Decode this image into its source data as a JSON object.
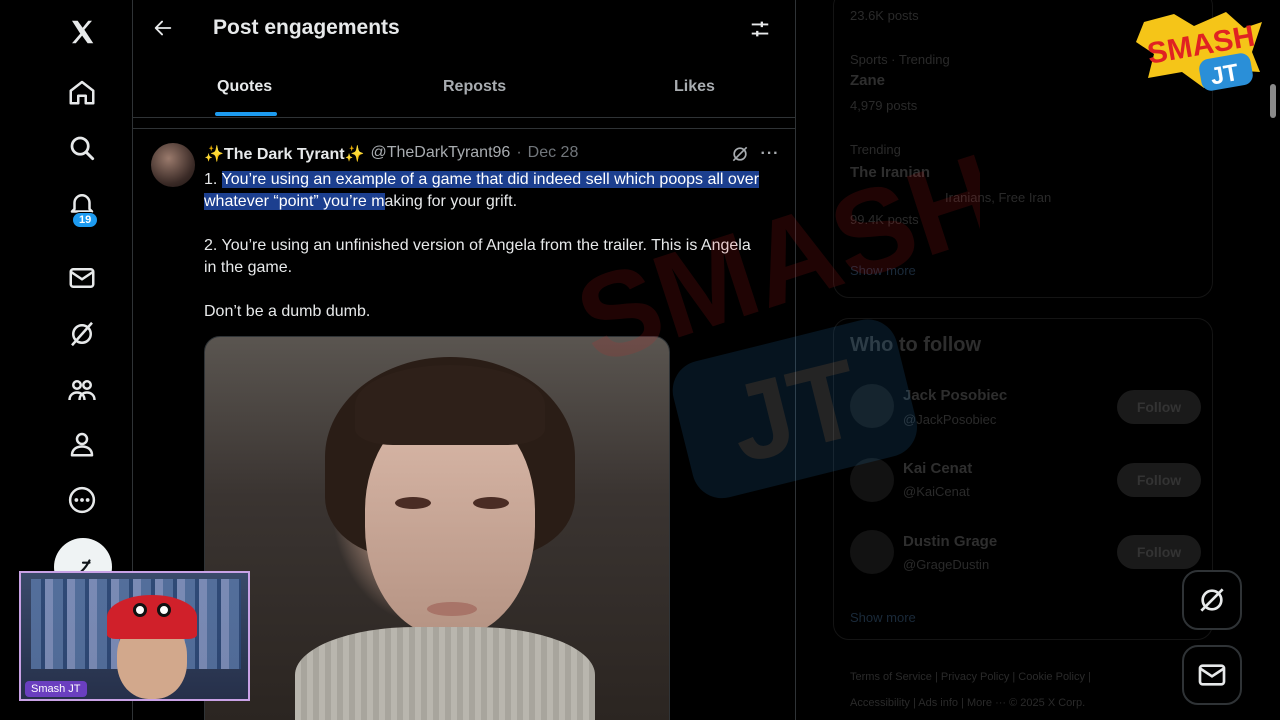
{
  "header": {
    "title": "Post engagements",
    "tabs": [
      {
        "label": "Quotes",
        "active": true
      },
      {
        "label": "Reposts",
        "active": false
      },
      {
        "label": "Likes",
        "active": false
      }
    ]
  },
  "nav": {
    "notification_count": "19",
    "icons": [
      "x-logo-icon",
      "home-icon",
      "search-icon",
      "bell-icon",
      "mail-icon",
      "grok-icon",
      "communities-icon",
      "profile-icon",
      "more-icon",
      "compose-icon"
    ]
  },
  "post": {
    "display_name": "✨The Dark Tyrant✨",
    "handle": "@TheDarkTyrant96",
    "separator": "·",
    "date": "Dec 28",
    "paragraph1_prefix": "1. ",
    "paragraph1_highlight": "You’re using an example of a game that did indeed sell which poops all over whatever “point” you’re m",
    "paragraph1_rest": "aking for your grift.",
    "paragraph2": "2. You’re using an unfinished version of Angela from the trailer. This is Angela in the game.",
    "paragraph3": "Don’t be a dumb dumb."
  },
  "sidebar": {
    "trend1_count": "23.6K posts",
    "trend2_category": "Sports · Trending",
    "trend2_name": "Zane",
    "trend2_count": "4,979 posts",
    "trend3_category": "Trending",
    "trend3_name": "The Iranian",
    "trend3_related": "Iranians, Free Iran",
    "trend3_count": "99.4K posts",
    "show_more": "Show more",
    "who_to_follow": "Who to follow",
    "follow_label": "Follow",
    "suggestions": [
      {
        "name": "Jack Posobiec",
        "handle": "@JackPosobiec"
      },
      {
        "name": "Kai Cenat",
        "handle": "@KaiCenat"
      },
      {
        "name": "Dustin Grage",
        "handle": "@GrageDustin"
      }
    ],
    "footer_line1": "Terms of Service  |  Privacy Policy  |  Cookie Policy  |",
    "footer_line2": "Accessibility  |  Ads info  |  More ···  © 2025 X Corp."
  },
  "overlay": {
    "logo_line1": "SMASH",
    "logo_line2": "JT",
    "webcam_label": "Smash JT"
  },
  "colors": {
    "accent": "#1d9bf0",
    "highlight": "#1c3f8f",
    "logo_red": "#e02222",
    "logo_yellow": "#f5c518",
    "logo_blue": "#2a8fd8"
  }
}
